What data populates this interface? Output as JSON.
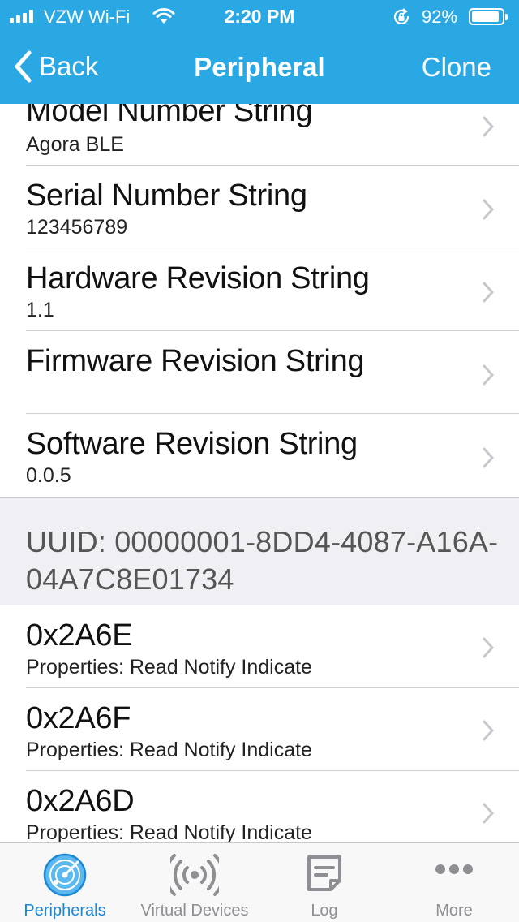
{
  "status_bar": {
    "carrier": "VZW Wi-Fi",
    "time": "2:20 PM",
    "battery": "92%",
    "battery_level": 0.92,
    "signal_icon": "signal-bars-icon",
    "wifi_icon": "wifi-icon",
    "lock_icon": "rotation-lock-icon"
  },
  "nav": {
    "back_label": "Back",
    "title": "Peripheral",
    "clone_label": "Clone"
  },
  "characteristics": [
    {
      "title": "Model Number String",
      "value": "Agora BLE"
    },
    {
      "title": "Serial Number String",
      "value": "123456789"
    },
    {
      "title": "Hardware Revision String",
      "value": "1.1"
    },
    {
      "title": "Firmware Revision String",
      "value": ""
    },
    {
      "title": "Software Revision String",
      "value": "0.0.5"
    }
  ],
  "service_header": {
    "uuid": "UUID: 00000001-8DD4-4087-A16A-04A7C8E01734"
  },
  "service_characteristics": [
    {
      "title": "0x2A6E",
      "value": "Properties: Read Notify Indicate"
    },
    {
      "title": "0x2A6F",
      "value": "Properties: Read Notify Indicate"
    },
    {
      "title": "0x2A6D",
      "value": "Properties: Read Notify Indicate"
    }
  ],
  "tabs": [
    {
      "label": "Peripherals",
      "icon": "radar-icon",
      "active": true
    },
    {
      "label": "Virtual Devices",
      "icon": "broadcast-icon",
      "active": false
    },
    {
      "label": "Log",
      "icon": "note-icon",
      "active": false
    },
    {
      "label": "More",
      "icon": "ellipsis-icon",
      "active": false
    }
  ],
  "colors": {
    "nav_background": "#2aa8e4",
    "tab_active": "#1c87d4",
    "tab_inactive": "#8e8e93",
    "section_header": "#efeff4"
  }
}
